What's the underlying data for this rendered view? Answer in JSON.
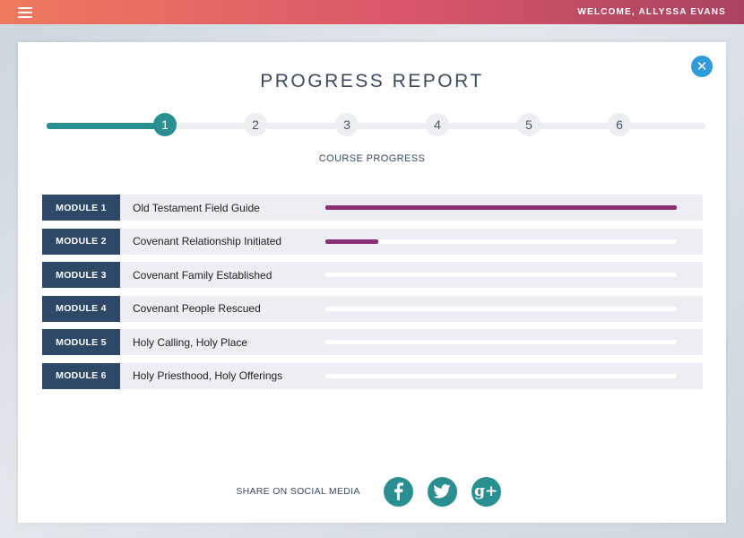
{
  "header": {
    "menu_icon": "hamburger-icon",
    "welcome": "WELCOME, ALLYSSA EVANS"
  },
  "panel": {
    "title": "PROGRESS REPORT",
    "close_icon": "close-icon",
    "subtitle": "COURSE PROGRESS"
  },
  "stepper": {
    "current": 1,
    "steps": [
      "1",
      "2",
      "3",
      "4",
      "5",
      "6"
    ]
  },
  "modules": [
    {
      "badge": "MODULE 1",
      "name": "Old Testament Field Guide",
      "progress": 1.0
    },
    {
      "badge": "MODULE 2",
      "name": "Covenant Relationship Initiated",
      "progress": 0.15
    },
    {
      "badge": "MODULE 3",
      "name": "Covenant Family Established",
      "progress": 0
    },
    {
      "badge": "MODULE 4",
      "name": "Covenant People Rescued",
      "progress": 0
    },
    {
      "badge": "MODULE 5",
      "name": "Holy Calling, Holy Place",
      "progress": 0
    },
    {
      "badge": "MODULE 6",
      "name": "Holy Priesthood, Holy Offerings",
      "progress": 0
    }
  ],
  "share": {
    "label": "SHARE ON SOCIAL MEDIA",
    "icons": [
      "facebook-icon",
      "twitter-icon",
      "google-plus-icon"
    ],
    "google_plus_glyph": "g+"
  },
  "colors": {
    "accent_teal": "#2a8f91",
    "progress_purple": "#8b2f72",
    "module_navy": "#2e4868",
    "close_blue": "#2f9bd8"
  }
}
